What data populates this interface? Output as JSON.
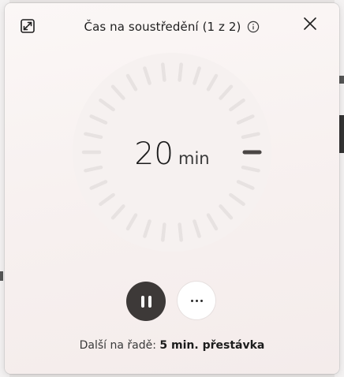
{
  "widget": {
    "title": "Čas na soustředění (1 z 2)",
    "icons": {
      "expand": "expand-icon",
      "info": "info-icon",
      "close": "close-icon",
      "pause": "pause-icon",
      "more": "more-icon"
    }
  },
  "timer": {
    "value": "20",
    "unit": "min",
    "tick_count": 30,
    "colors": {
      "dial_face": "#f6f1f0",
      "tick": "#e7e2e1",
      "indicator": "#4a4644"
    }
  },
  "controls": {
    "pause_label": "Pozastavit",
    "more_label": "Další možnosti"
  },
  "next": {
    "prefix": "Další na řadě: ",
    "value": "5 min. přestávka"
  },
  "colors": {
    "pause_button": "#3d3938",
    "text_primary": "#1f1f1f"
  }
}
